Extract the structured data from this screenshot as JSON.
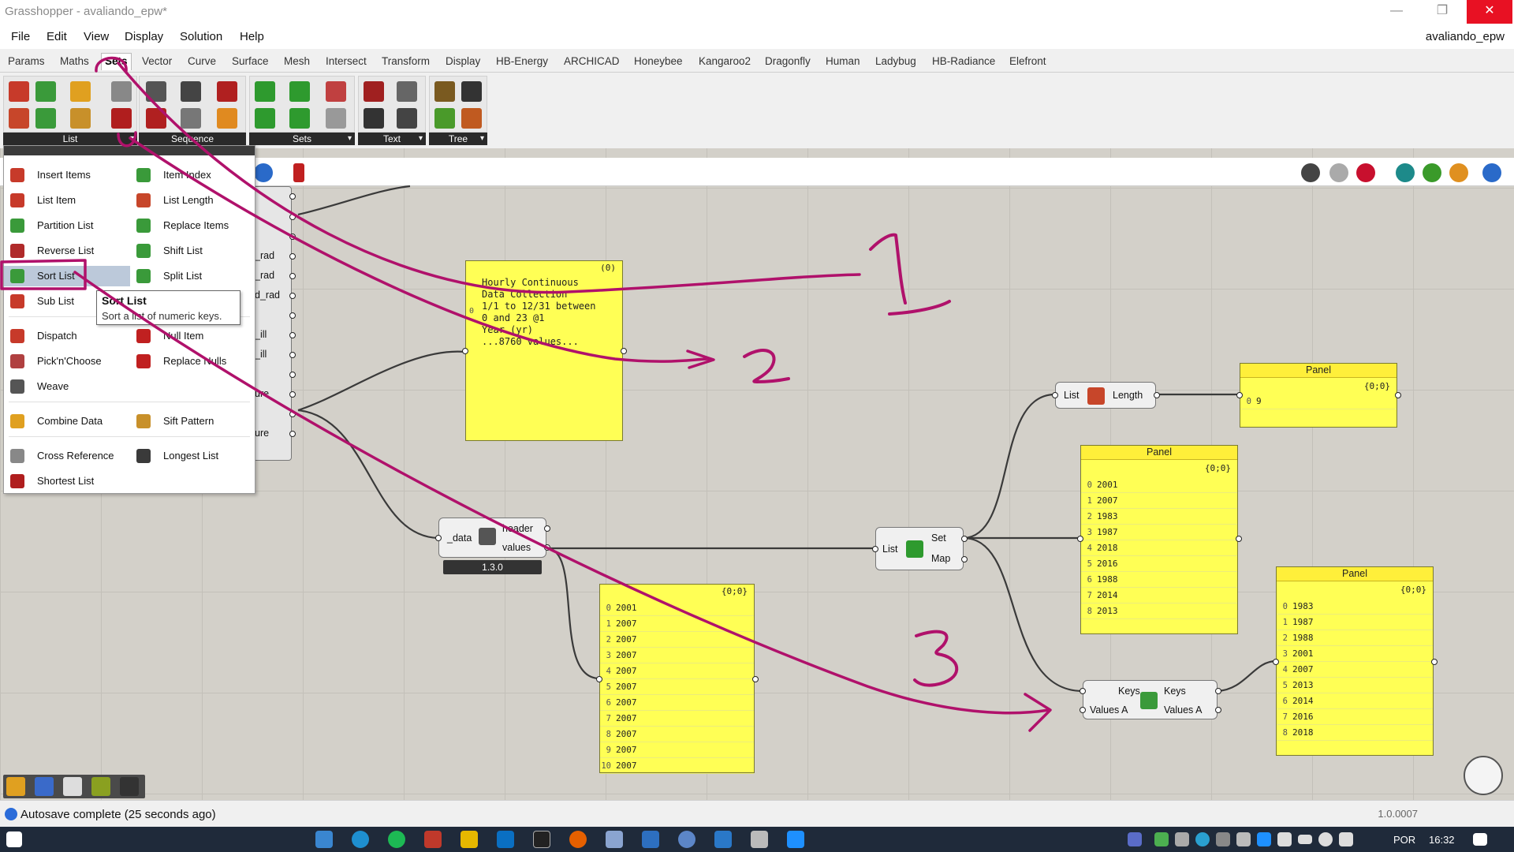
{
  "window": {
    "title": "Grasshopper - avaliando_epw*",
    "doc_name": "avaliando_epw"
  },
  "menu": [
    "File",
    "Edit",
    "View",
    "Display",
    "Solution",
    "Help"
  ],
  "tabs": [
    "Params",
    "Maths",
    "Sets",
    "Vector",
    "Curve",
    "Surface",
    "Mesh",
    "Intersect",
    "Transform",
    "Display",
    "HB-Energy",
    "ARCHICAD",
    "Honeybee",
    "Kangaroo2",
    "Dragonfly",
    "Human",
    "Ladybug",
    "HB-Radiance",
    "Elefront"
  ],
  "active_tab": "Sets",
  "ribbon_groups": [
    "List",
    "Sequence",
    "Sets",
    "Text",
    "Tree"
  ],
  "dropdown": {
    "left_col": [
      "Insert Items",
      "List Item",
      "Partition List",
      "Reverse List",
      "Sort List",
      "Sub List",
      "Dispatch",
      "Pick'n'Choose",
      "Weave",
      "Combine Data",
      "Cross Reference",
      "Shortest List"
    ],
    "right_col": [
      "Item Index",
      "List Length",
      "Replace Items",
      "Shift List",
      "Split List",
      "Null Item",
      "Replace Nulls",
      "Sift Pattern",
      "Longest List"
    ],
    "selected": "Sort List"
  },
  "tooltip": {
    "title": "Sort List",
    "description": "Sort a list of numeric keys."
  },
  "partial_outputs": [
    "_rad",
    "_rad",
    "d_rad",
    "_ill",
    "_ill",
    "ure",
    "ure"
  ],
  "components": {
    "deconstruct": {
      "input": "_data",
      "outputs": [
        "header",
        "values"
      ],
      "version": "1.3.0"
    },
    "list_length": {
      "input": "List",
      "output": "Length"
    },
    "set_map": {
      "input": "List",
      "outputs": [
        "Set",
        "Map"
      ]
    },
    "sort_list": {
      "inputs": [
        "Keys",
        "Values A"
      ],
      "outputs": [
        "Keys",
        "Values A"
      ]
    }
  },
  "panels": {
    "header_panel": {
      "path": "(0)",
      "index": "0",
      "lines": [
        "Hourly Continuous",
        "Data Collection",
        "1/1 to 12/31 between",
        "0 and 23 @1",
        "Year (yr)",
        "...8760 values..."
      ]
    },
    "values_panel": {
      "path": "{0;0}",
      "rows": [
        "2001",
        "2007",
        "2007",
        "2007",
        "2007",
        "2007",
        "2007",
        "2007",
        "2007",
        "2007",
        "2007"
      ]
    },
    "length_panel": {
      "title": "Panel",
      "path": "{0;0}",
      "rows": [
        "9"
      ]
    },
    "set_panel": {
      "title": "Panel",
      "path": "{0;0}",
      "rows": [
        "2001",
        "2007",
        "1983",
        "1987",
        "2018",
        "2016",
        "1988",
        "2014",
        "2013"
      ]
    },
    "sorted_panel": {
      "title": "Panel",
      "path": "{0;0}",
      "rows": [
        "1983",
        "1987",
        "1988",
        "2001",
        "2007",
        "2013",
        "2014",
        "2016",
        "2018"
      ]
    }
  },
  "status": {
    "text": "Autosave complete (25 seconds ago)",
    "version": "1.0.0007"
  },
  "taskbar": {
    "lang": "POR",
    "time": "16:32"
  },
  "colors": {
    "panel_yellow": "#ffff55",
    "annotation": "#b0116b",
    "close_red": "#e81123"
  },
  "annotations": [
    "1",
    "2",
    "3"
  ]
}
